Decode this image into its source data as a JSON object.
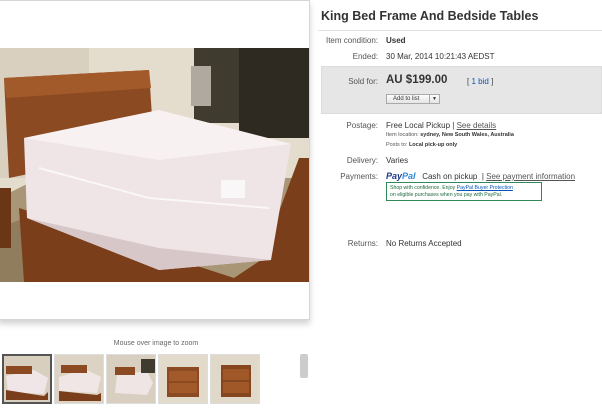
{
  "listing": {
    "title": "King Bed Frame And Bedside Tables",
    "item_condition_label": "Item condition:",
    "item_condition": "Used",
    "ended_label": "Ended:",
    "ended": "30 Mar, 2014   10:21:43 AEDST",
    "sold_for_label": "Sold for:",
    "price": "AU $199.00",
    "bids_prefix": "[",
    "bids_link": "1 bid",
    "bids_suffix": "]",
    "watch_button": "Add to list",
    "postage_label": "Postage:",
    "postage": "Free Local Pickup",
    "postage_separator": "|",
    "see_details": "See details",
    "item_location_label": "Item location:",
    "item_location": "sydney, New South Wales, Australia",
    "posts_to_label": "Posts to:",
    "posts_to": "Local pick-up only",
    "delivery_label": "Delivery:",
    "delivery": "Varies",
    "payments_label": "Payments:",
    "paypal_part1": "Pay",
    "paypal_part2": "Pal",
    "payment_method": "Cash on pickup",
    "payments_separator": "|",
    "see_payment": "See payment information",
    "protection_line1_a": "Shop with confidence. Enjoy ",
    "protection_link": "PayPal Buyer Protection",
    "protection_line2": "on eligible purchases when you pay with PayPal.",
    "returns_label": "Returns:",
    "returns": "No Returns Accepted"
  },
  "gallery": {
    "zoom_hint": "Mouse over image to zoom",
    "thumbnails": [
      "bed-photo-thumbnail-1",
      "bed-photo-thumbnail-2",
      "bed-photo-thumbnail-3",
      "bedside-table-thumbnail-1",
      "bedside-table-thumbnail-2"
    ]
  },
  "colors": {
    "link": "#0654ba",
    "price_box": "#e6e6e6",
    "protection_border": "#2e8b57"
  }
}
